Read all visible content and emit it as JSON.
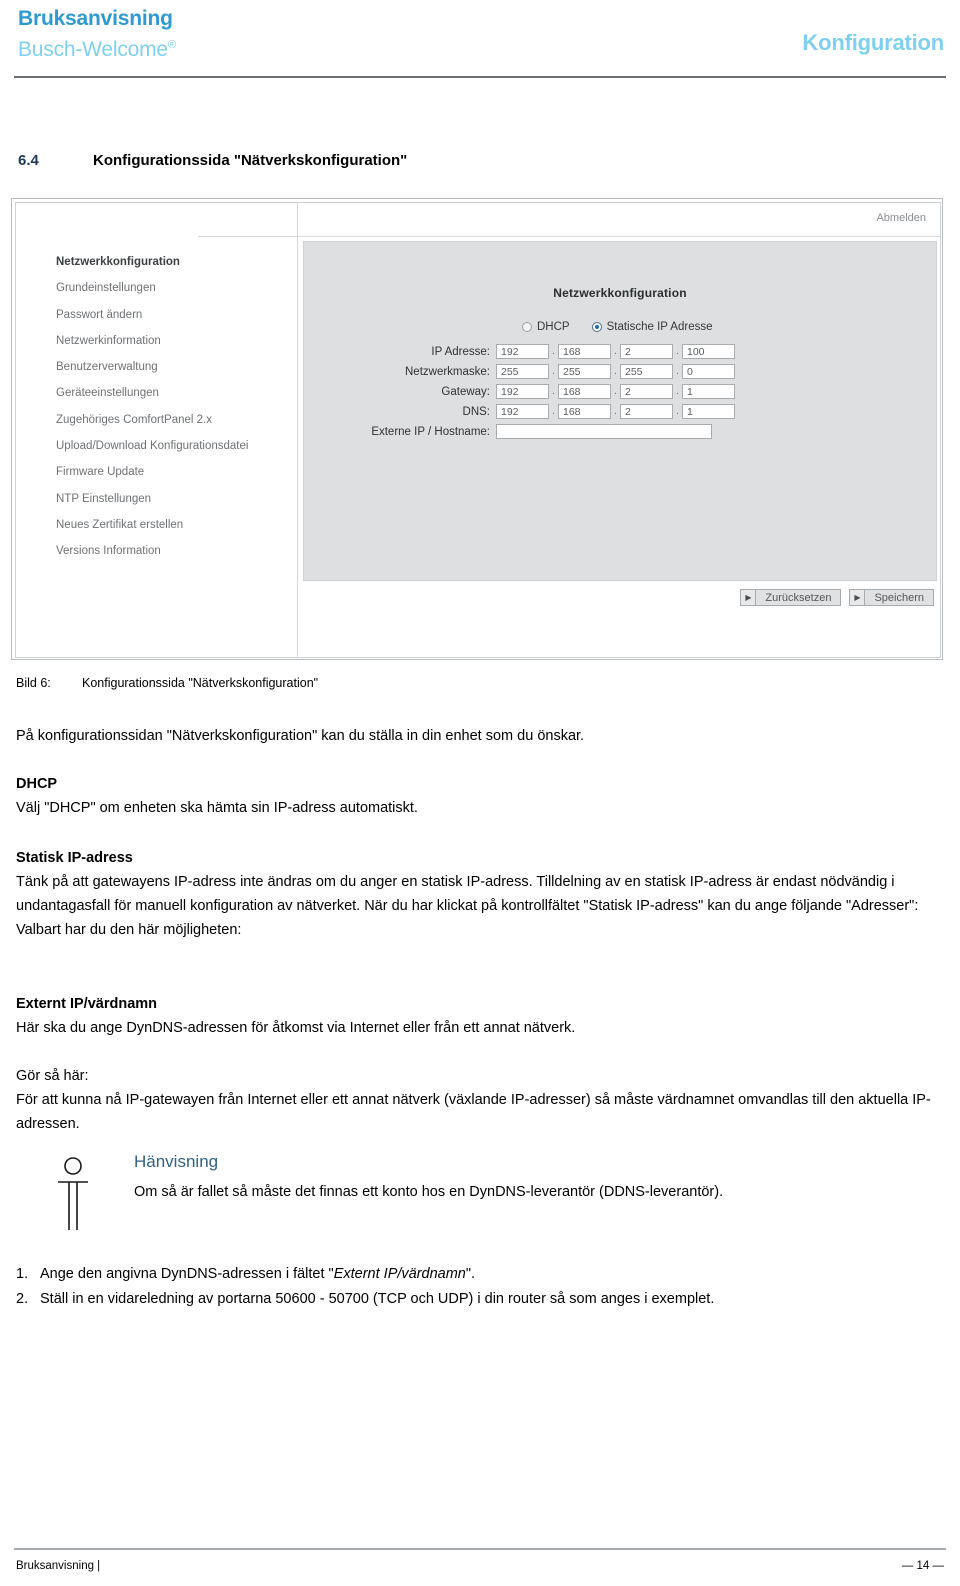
{
  "header": {
    "brand_line1": "Bruksanvisning",
    "brand_line2": "Busch-Welcome",
    "brand_reg": "®",
    "right_title": "Konfiguration"
  },
  "section": {
    "number": "6.4",
    "title": "Konfigurationssida \"Nätverkskonfiguration\""
  },
  "screenshot": {
    "logout_label": "Abmelden",
    "nav_items": [
      "Netzwerkkonfiguration",
      "Grundeinstellungen",
      "Passwort ändern",
      "Netzwerkinformation",
      "Benutzerverwaltung",
      "Geräteeinstellungen",
      "Zugehöriges ComfortPanel 2.x",
      "Upload/Download Konfigurationsdatei",
      "Firmware Update",
      "NTP Einstellungen",
      "Neues Zertifikat erstellen",
      "Versions Information"
    ],
    "panel_title": "Netzwerkkonfiguration",
    "radios": [
      {
        "label": "DHCP",
        "checked": false
      },
      {
        "label": "Statische IP Adresse",
        "checked": true
      }
    ],
    "fields": [
      {
        "label": "IP Adresse:",
        "octets": [
          "192",
          "168",
          "2",
          "100"
        ]
      },
      {
        "label": "Netzwerkmaske:",
        "octets": [
          "255",
          "255",
          "255",
          "0"
        ]
      },
      {
        "label": "Gateway:",
        "octets": [
          "192",
          "168",
          "2",
          "1"
        ]
      },
      {
        "label": "DNS:",
        "octets": [
          "192",
          "168",
          "2",
          "1"
        ]
      }
    ],
    "hostname_field": {
      "label": "Externe IP / Hostname:",
      "value": ""
    },
    "separator": ".",
    "arrow_glyph": "▶",
    "buttons": [
      {
        "label": "Zurücksetzen"
      },
      {
        "label": "Speichern"
      }
    ]
  },
  "caption": {
    "key": "Bild 6:",
    "text": "Konfigurationssida \"Nätverkskonfiguration\""
  },
  "body": {
    "intro": "På konfigurationssidan \"Nätverkskonfiguration\" kan du ställa in din enhet som du önskar.",
    "dhcp_heading": "DHCP",
    "dhcp_text": "Välj \"DHCP\" om enheten ska hämta sin IP-adress automatiskt.",
    "static_heading": "Statisk IP-adress",
    "static_text": "Tänk på att gatewayens IP-adress inte ändras om du anger en statisk IP-adress. Tilldelning av en statisk IP-adress är endast nödvändig i undantagasfall för manuell konfiguration av nätverket. När du har klickat på kontrollfältet \"Statisk IP-adress\" kan du ange följande \"Adresser\":",
    "static_text2": "Valbart har du den här möjligheten:",
    "ext_heading": "Externt IP/värdnamn",
    "ext_text": "Här ska du ange DynDNS-adressen för åtkomst via Internet eller från ett annat nätverk.",
    "gor_heading": "Gör så här:",
    "gor_text": "För att kunna nå IP-gatewayen från Internet eller ett annat nätverk (växlande IP-adresser) så måste värdnamnet omvandlas till den aktuella IP-adressen."
  },
  "note": {
    "title": "Hänvisning",
    "text": "Om så är fallet så måste det finnas ett konto hos en DynDNS-leverantör (DDNS-leverantör)."
  },
  "steps": [
    {
      "num": "1.",
      "pre": "Ange den angivna DynDNS-adressen i fältet \"",
      "em": "Externt IP/värdnamn",
      "post": "\"."
    },
    {
      "num": "2.",
      "pre": "Ställ in en vidareledning av portarna 50600 - 50700 (TCP och UDP) i din router så som anges i exemplet.",
      "em": "",
      "post": ""
    }
  ],
  "footer": {
    "left": "Bruksanvisning |",
    "right": "— 14 —"
  },
  "colors": {
    "brand_dark": "#2e9ad0",
    "brand_light": "#7fd0ef",
    "note_title": "#2f6186",
    "heading_num": "#1b3a5c",
    "panel_bg": "#dddfe0",
    "radio_accent": "#1f6bc0"
  }
}
